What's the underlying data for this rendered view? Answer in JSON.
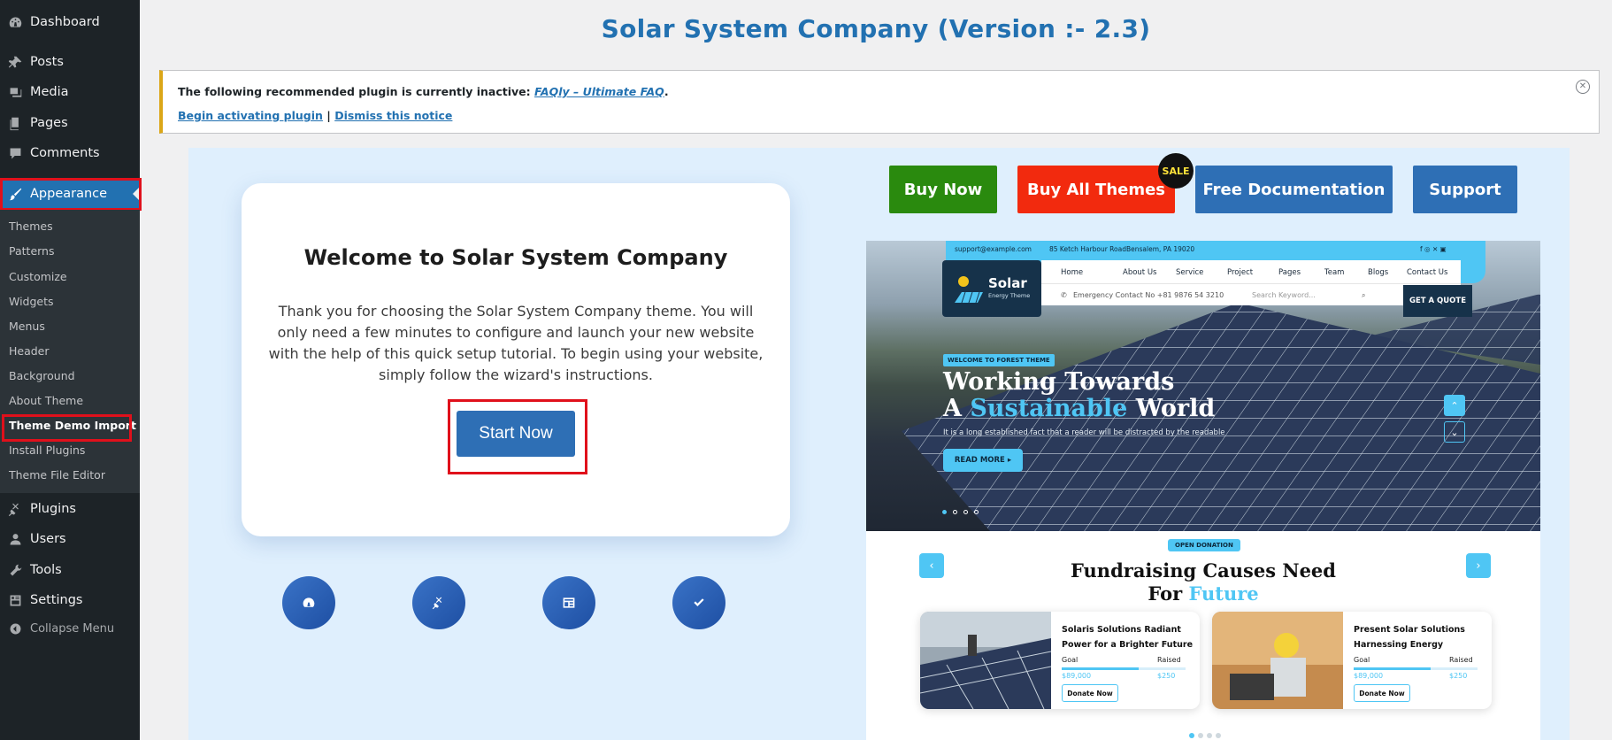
{
  "sidebar": {
    "dashboard": "Dashboard",
    "posts": "Posts",
    "media": "Media",
    "pages": "Pages",
    "comments": "Comments",
    "appearance": "Appearance",
    "submenu": [
      "Themes",
      "Patterns",
      "Customize",
      "Widgets",
      "Menus",
      "Header",
      "Background",
      "About Theme",
      "Theme Demo Import",
      "Install Plugins",
      "Theme File Editor"
    ],
    "plugins": "Plugins",
    "users": "Users",
    "tools": "Tools",
    "settings": "Settings",
    "collapse": "Collapse Menu"
  },
  "page": {
    "title": "Solar System Company (Version :- 2.3)"
  },
  "notice": {
    "text": "The following recommended plugin is currently inactive: ",
    "plugin_link": "FAQly – Ultimate FAQ",
    "period": ".",
    "activate": "Begin activating plugin",
    "separator": " | ",
    "dismiss": "Dismiss this notice"
  },
  "welcome": {
    "title": "Welcome to Solar System Company",
    "description": "Thank you for choosing the Solar System Company theme. You will only need a few minutes to configure and launch your new website with the help of this quick setup tutorial. To begin using your website, simply follow the wizard's instructions.",
    "start": "Start Now"
  },
  "step_icons": [
    "dashboard-icon",
    "plugin-icon",
    "layout-icon",
    "check-icon"
  ],
  "actions": {
    "buy_now": "Buy Now",
    "buy_all": "Buy All Themes",
    "sale": "SALE",
    "docs": "Free Documentation",
    "support": "Support"
  },
  "preview": {
    "email": "support@example.com",
    "address": "85 Ketch Harbour RoadBensalem, PA 19020",
    "logo_title": "Solar",
    "logo_sub": "Energy Theme",
    "nav": [
      "Home",
      "About Us",
      "Service",
      "Project",
      "Pages",
      "Team",
      "Blogs",
      "Contact Us"
    ],
    "emergency": "Emergency Contact No +81 9876 54 3210",
    "search_placeholder": "Search Keyword...",
    "quote": "GET A QUOTE",
    "hero_badge": "WELCOME TO FOREST THEME",
    "hero_line1": "Working Towards",
    "hero_line2_a": "A ",
    "hero_line2_hl": "Sustainable",
    "hero_line2_b": " World",
    "hero_text": "It is a long established fact that a reader will be distracted by the readable",
    "read_more": "READ MORE",
    "fund_badge": "OPEN DONATION",
    "fund_line1": "Fundraising Causes Need",
    "fund_line2_a": "For ",
    "fund_line2_hl": "Future",
    "causes": [
      {
        "title": "Solaris Solutions Radiant Power for a Brighter Future",
        "goal_label": "Goal",
        "raised_label": "Raised",
        "goal": "$89,000",
        "raised": "$250",
        "progress": 0.62,
        "donate": "Donate Now"
      },
      {
        "title": "Present Solar Solutions Harnessing Energy",
        "goal_label": "Goal",
        "raised_label": "Raised",
        "goal": "$89,000",
        "raised": "$250",
        "progress": 0.62,
        "donate": "Donate Now"
      }
    ]
  },
  "colors": {
    "wp_blue": "#2271b1",
    "buy_now": "#2a8a0e",
    "buy_all": "#f22a0e",
    "docs": "#2e6fb5",
    "accent": "#4fc6f4",
    "highlight": "#e0101b"
  }
}
